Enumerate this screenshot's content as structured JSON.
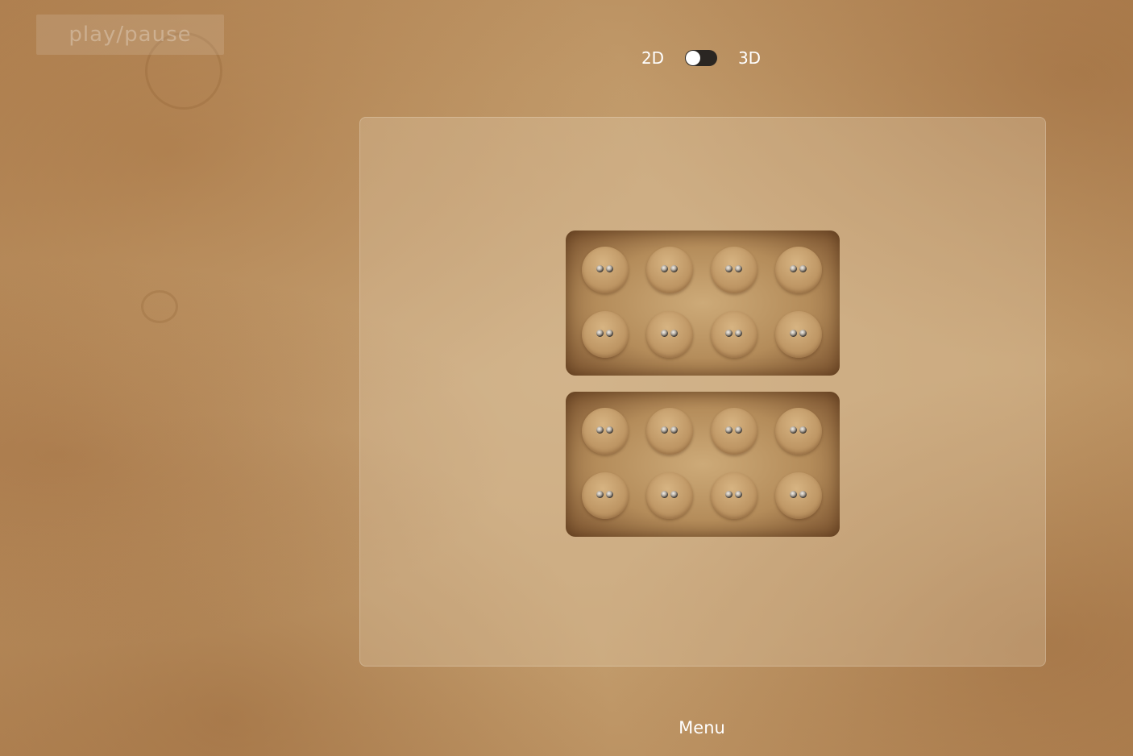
{
  "controls": {
    "play_pause_label": "play/pause",
    "label_2d": "2D",
    "label_3d": "3D",
    "mode_3d_enabled": false
  },
  "board": {
    "slabs": [
      {
        "rows": 2,
        "columns": 4
      },
      {
        "rows": 2,
        "columns": 4
      }
    ]
  },
  "footer": {
    "menu_label": "Menu"
  },
  "colors": {
    "background": "#c19a6a",
    "switch_track": "#2a2622",
    "text": "#ffffff"
  }
}
